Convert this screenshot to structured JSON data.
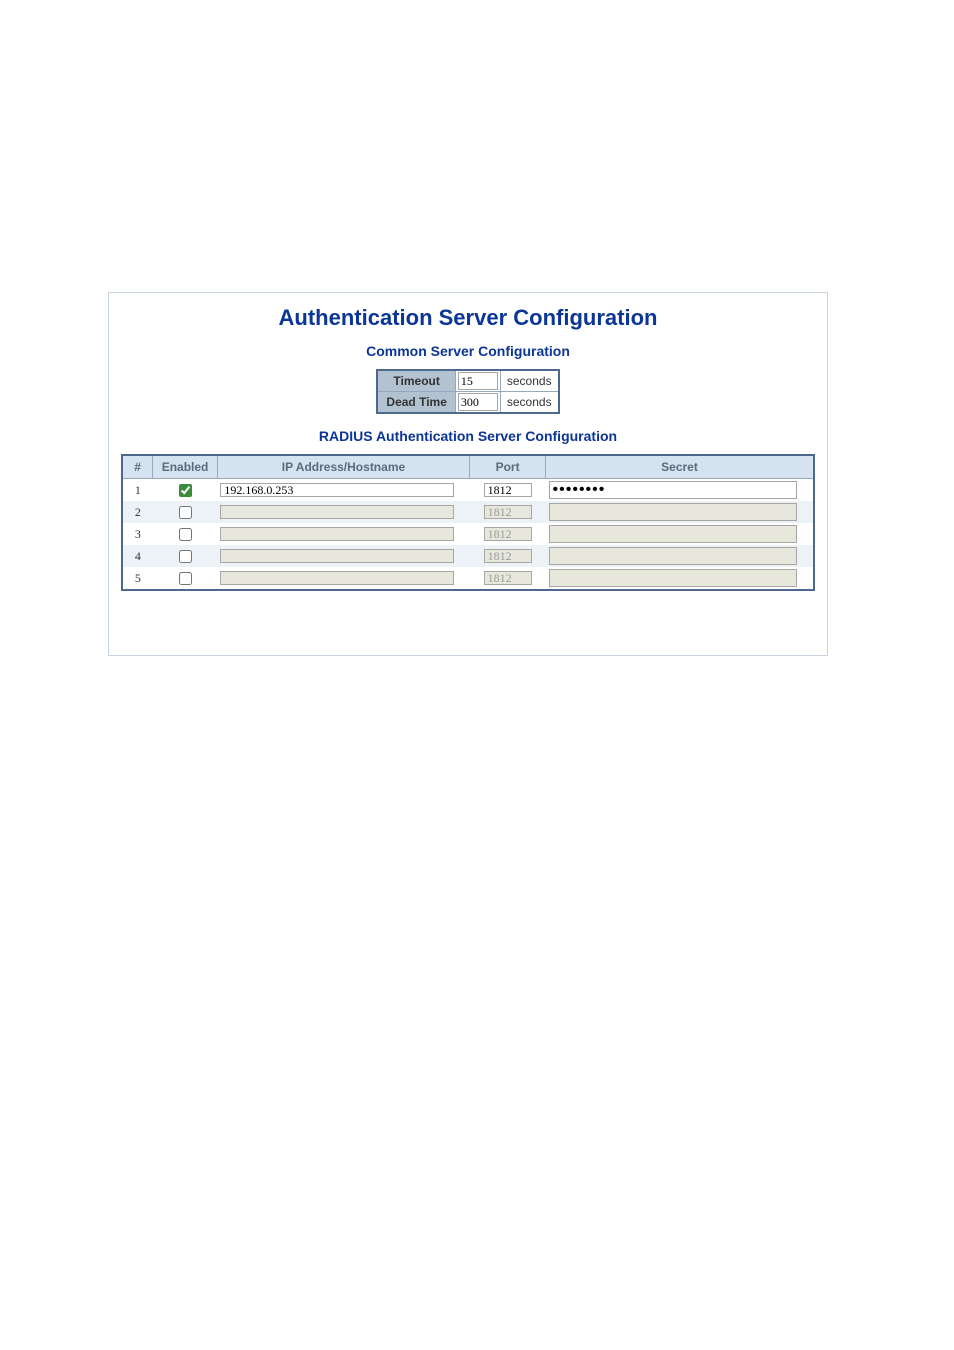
{
  "title": "Authentication Server Configuration",
  "common": {
    "heading": "Common Server Configuration",
    "rows": [
      {
        "label": "Timeout",
        "value": "15",
        "unit": "seconds"
      },
      {
        "label": "Dead Time",
        "value": "300",
        "unit": "seconds"
      }
    ]
  },
  "radius": {
    "heading": "RADIUS Authentication Server Configuration",
    "headers": {
      "num": "#",
      "enabled": "Enabled",
      "ip": "IP Address/Hostname",
      "port": "Port",
      "secret": "Secret"
    },
    "rows": [
      {
        "n": "1",
        "enabled": true,
        "ip": "192.168.0.253",
        "port": "1812",
        "secret": "••••••••",
        "disabled": false
      },
      {
        "n": "2",
        "enabled": false,
        "ip": "",
        "port": "1812",
        "secret": "",
        "disabled": true
      },
      {
        "n": "3",
        "enabled": false,
        "ip": "",
        "port": "1812",
        "secret": "",
        "disabled": true
      },
      {
        "n": "4",
        "enabled": false,
        "ip": "",
        "port": "1812",
        "secret": "",
        "disabled": true
      },
      {
        "n": "5",
        "enabled": false,
        "ip": "",
        "port": "1812",
        "secret": "",
        "disabled": true
      }
    ]
  }
}
